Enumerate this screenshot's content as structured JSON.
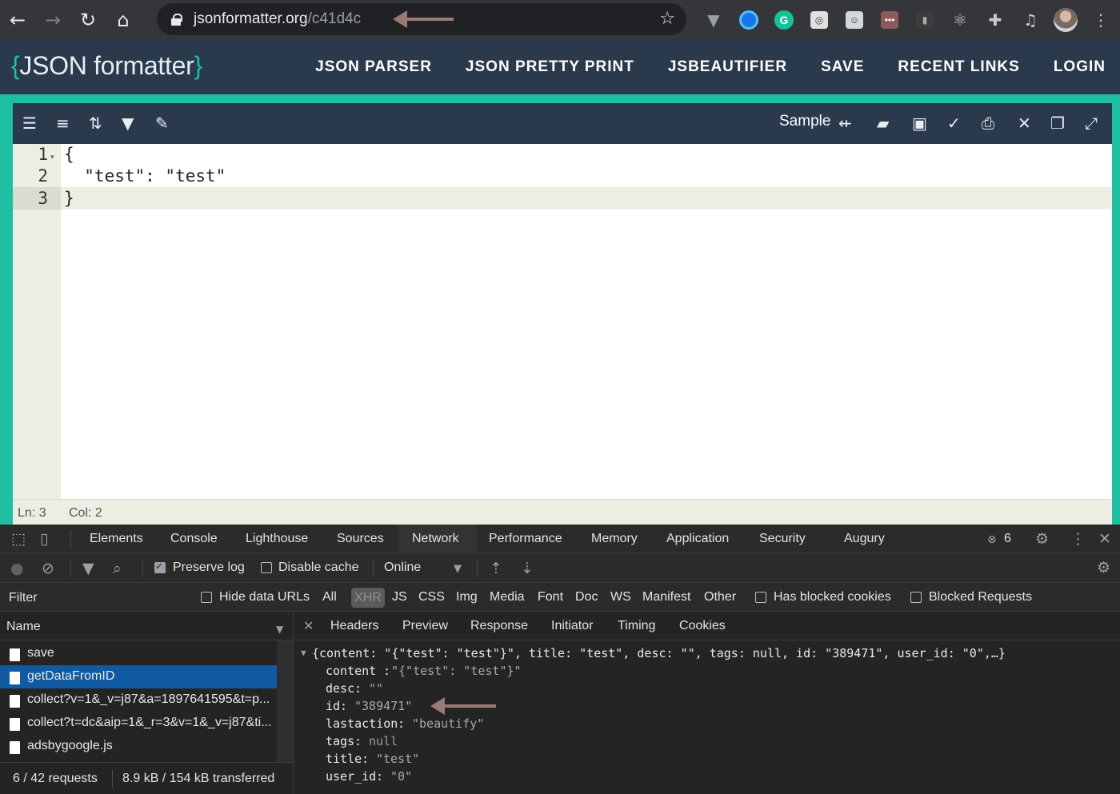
{
  "browser": {
    "url_host": "jsonformatter.org",
    "url_path": "/c41d4c",
    "nav_icons": [
      "back-arrow-icon",
      "forward-arrow-icon",
      "reload-icon",
      "home-icon"
    ],
    "extension_icons": [
      "vue-icon",
      "circle-extension-icon",
      "grammarly-icon",
      "screenshot-icon",
      "robot-icon",
      "dots-extension-icon",
      "chart-extension-icon",
      "react-icon",
      "puzzle-icon",
      "media-queue-icon",
      "profile-avatar",
      "kebab-menu-icon"
    ]
  },
  "site": {
    "logo_text": "JSON formatter",
    "logo_brace_open": "{",
    "logo_brace_close": "}",
    "nav": [
      "JSON PARSER",
      "JSON PRETTY PRINT",
      "JSBEAUTIFIER",
      "SAVE",
      "RECENT LINKS",
      "LOGIN"
    ]
  },
  "editor": {
    "sample_label": "Sample",
    "line_numbers": [
      "1",
      "2",
      "3"
    ],
    "lines": [
      "{",
      "  \"test\": \"test\"",
      "}"
    ],
    "status": {
      "ln": "Ln: 3",
      "col": "Col: 2"
    }
  },
  "devtools": {
    "tabs": [
      "Elements",
      "Console",
      "Lighthouse",
      "Sources",
      "Network",
      "Performance",
      "Memory",
      "Application",
      "Security",
      "Augury"
    ],
    "active_tab": "Network",
    "error_count": "6",
    "toolbar": {
      "preserve_log": "Preserve log",
      "disable_cache": "Disable cache",
      "throttle": "Online"
    },
    "filter": {
      "label": "Filter",
      "hide_data_urls": "Hide data URLs",
      "types": [
        "All",
        "XHR",
        "JS",
        "CSS",
        "Img",
        "Media",
        "Font",
        "Doc",
        "WS",
        "Manifest",
        "Other"
      ],
      "active_type": "XHR",
      "has_blocked_cookies": "Has blocked cookies",
      "blocked_requests": "Blocked Requests"
    },
    "requests": {
      "header": "Name",
      "items": [
        "save",
        "getDataFromID",
        "collect?v=1&_v=j87&a=1897641595&t=p...",
        "collect?t=dc&aip=1&_r=3&v=1&_v=j87&ti...",
        "adsbygoogle.js"
      ],
      "selected": "getDataFromID",
      "summary_requests": "6 / 42 requests",
      "summary_transfer": "8.9 kB / 154 kB transferred"
    },
    "detail_tabs": [
      "Headers",
      "Preview",
      "Response",
      "Initiator",
      "Timing",
      "Cookies"
    ],
    "active_detail_tab": "Preview",
    "preview": {
      "summary": "{content: \"{\"test\": \"test\"}\", title: \"test\", desc: \"\", tags: null, id: \"389471\", user_id: \"0\",…}",
      "rows": [
        {
          "key": "content",
          "value": "\"{\"test\": \"test\"}\""
        },
        {
          "key": "desc",
          "value": "\"\""
        },
        {
          "key": "id",
          "value": "\"389471\""
        },
        {
          "key": "lastaction",
          "value": "\"beautify\""
        },
        {
          "key": "tags",
          "value": "null"
        },
        {
          "key": "title",
          "value": "\"test\""
        },
        {
          "key": "user_id",
          "value": "\"0\""
        }
      ]
    }
  },
  "colors": {
    "accent_teal": "#1fbfa3",
    "header_navy": "#2a3a4c",
    "annotation_arrow": "#9c7a74",
    "devtools_selected": "#0f5aa0"
  }
}
